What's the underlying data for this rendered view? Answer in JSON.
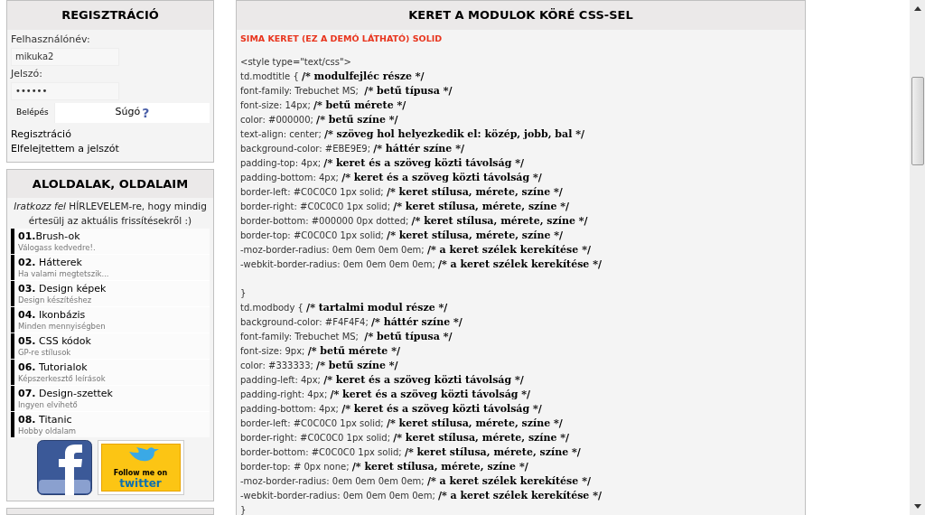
{
  "login": {
    "title": "REGISZTRÁCIÓ",
    "username_label": "Felhasználónév:",
    "username_value": "mikuka2",
    "password_label": "Jelszó:",
    "password_value": "••••••",
    "login_button": "Belépés",
    "help_label": "Súgó",
    "help_mark": "?",
    "links": [
      "Regisztráció",
      "Elfelejtettem a jelszót"
    ]
  },
  "subpages": {
    "title": "ALOLDALAK, OLDALAIM",
    "newsletter": "*Iratkozz fel* HÍRLEVELEM-re, hogy mindig értesülj az aktuális frissítésekről :)",
    "items": [
      {
        "title": "**01.**Brush-ok",
        "subtitle": "Válogass kedvedre!."
      },
      {
        "title": "**02.** Hátterek",
        "subtitle": "Ha valami megtetszik..."
      },
      {
        "title": "**03.** Design képek",
        "subtitle": "Design készítéshez"
      },
      {
        "title": "**04.** Ikonbázis",
        "subtitle": "Minden mennyiségben"
      },
      {
        "title": "**05.** CSS kódok",
        "subtitle": "GP-re stílusok"
      },
      {
        "title": "**06.** Tutorialok",
        "subtitle": "Képszerkesztő leírások"
      },
      {
        "title": "**07.** Design-szettek",
        "subtitle": "Ingyen elvihető"
      },
      {
        "title": "**08.** Titanic",
        "subtitle": "Hobby oldalam"
      }
    ],
    "twitter_badge": [
      "Follow me on",
      "twitter"
    ]
  },
  "article": {
    "title": "KERET A MODULOK KÖRÉ CSS-SEL",
    "subtitle": "SIMA KERET (EZ A DEMÓ LÁTHATÓ) SOLID",
    "lines": [
      {
        "code": "<style type=\"text/css\">"
      },
      {
        "code": "td.modtitle { ",
        "comment": "/* modulfejléc része */"
      },
      {
        "code": "font-family: Trebuchet MS;  ",
        "comment": "/* betű típusa */"
      },
      {
        "code": "font-size: 14px; ",
        "comment": "/* betű mérete */"
      },
      {
        "code": "color: #000000; ",
        "comment": "/* betű színe */"
      },
      {
        "code": "text-align: center; ",
        "comment": "/* szöveg hol helyezkedik el: közép, jobb, bal */"
      },
      {
        "code": "background-color: #EBE9E9; ",
        "comment": "/* háttér színe */"
      },
      {
        "code": "padding-top: 4px; ",
        "comment": "/* keret és a szöveg közti távolság */"
      },
      {
        "code": "padding-bottom: 4px; ",
        "comment": "/* keret és a szöveg közti távolság */"
      },
      {
        "code": "border-left: #C0C0C0 1px solid; ",
        "comment": "/* keret stílusa, mérete, színe */"
      },
      {
        "code": "border-right: #C0C0C0 1px solid; ",
        "comment": "/* keret stílusa, mérete, színe */"
      },
      {
        "code": "border-bottom: #000000 0px dotted; ",
        "comment": "/* keret stílusa, mérete, színe */"
      },
      {
        "code": "border-top: #C0C0C0 1px solid; ",
        "comment": "/* keret stílusa, mérete, színe */"
      },
      {
        "code": "-moz-border-radius: 0em 0em 0em 0em; ",
        "comment": "/* a keret szélek kerekítése */"
      },
      {
        "code": "-webkit-border-radius: 0em 0em 0em 0em; ",
        "comment": "/* a keret szélek kerekítése */"
      },
      {
        "blank": true
      },
      {
        "code": "}"
      },
      {
        "code": "td.modbody { ",
        "comment": "/* tartalmi modul része */"
      },
      {
        "code": "background-color: #F4F4F4; ",
        "comment": "/* háttér színe */"
      },
      {
        "code": "font-family: Trebuchet MS;  ",
        "comment": "/* betű típusa */"
      },
      {
        "code": "font-size: 9px; ",
        "comment": "/* betű mérete */"
      },
      {
        "code": "color: #333333; ",
        "comment": "/* betű színe */"
      },
      {
        "code": "padding-left: 4px; ",
        "comment": "/* keret és a szöveg közti távolság */"
      },
      {
        "code": "padding-right: 4px; ",
        "comment": "/* keret és a szöveg közti távolság */"
      },
      {
        "code": "padding-bottom: 4px; ",
        "comment": "/* keret és a szöveg közti távolság */"
      },
      {
        "code": "border-left: #C0C0C0 1px solid; ",
        "comment": "/* keret stílusa, mérete, színe */"
      },
      {
        "code": "border-right: #C0C0C0 1px solid; ",
        "comment": "/* keret stílusa, mérete, színe */"
      },
      {
        "code": "border-bottom: #C0C0C0 1px solid; ",
        "comment": "/* keret stílusa, mérete, színe */"
      },
      {
        "code": "border-top: # 0px none; ",
        "comment": "/* keret stílusa, mérete, színe */"
      },
      {
        "code": "-moz-border-radius: 0em 0em 0em 0em; ",
        "comment": "/* a keret szélek kerekítése */"
      },
      {
        "code": "-webkit-border-radius: 0em 0em 0em 0em; ",
        "comment": "/* a keret szélek kerekítése */"
      },
      {
        "code": "}"
      }
    ]
  }
}
